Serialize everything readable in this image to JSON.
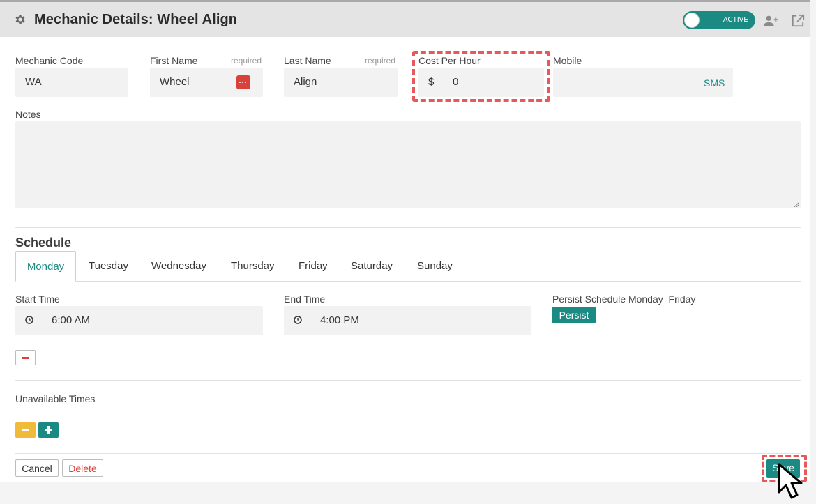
{
  "header": {
    "title": "Mechanic Details:  Wheel Align",
    "status_label": "ACTIVE",
    "icons": [
      "gear-icon",
      "add-user-icon",
      "external-link-icon"
    ]
  },
  "form": {
    "mechanic_code": {
      "label": "Mechanic Code",
      "value": "WA"
    },
    "first_name": {
      "label": "First Name",
      "required": "required",
      "value": "Wheel"
    },
    "last_name": {
      "label": "Last Name",
      "required": "required",
      "value": "Align"
    },
    "cost_per_hour": {
      "label": "Cost Per Hour",
      "prefix": "$",
      "value": "0"
    },
    "mobile": {
      "label": "Mobile",
      "value": "",
      "action": "SMS"
    },
    "notes": {
      "label": "Notes",
      "value": ""
    }
  },
  "schedule": {
    "title": "Schedule",
    "tabs": [
      "Monday",
      "Tuesday",
      "Wednesday",
      "Thursday",
      "Friday",
      "Saturday",
      "Sunday"
    ],
    "active_tab": "Monday",
    "start_time": {
      "label": "Start Time",
      "value": "6:00 AM"
    },
    "end_time": {
      "label": "End Time",
      "value": "4:00 PM"
    },
    "persist": {
      "label": "Persist Schedule Monday–Friday",
      "button": "Persist"
    }
  },
  "unavailable": {
    "label": "Unavailable Times"
  },
  "footer": {
    "cancel": "Cancel",
    "delete": "Delete",
    "save": "Save"
  },
  "colors": {
    "accent": "#1b8a83",
    "danger": "#d9423a",
    "warning": "#f0bb3a",
    "highlight": "#e8585a"
  }
}
